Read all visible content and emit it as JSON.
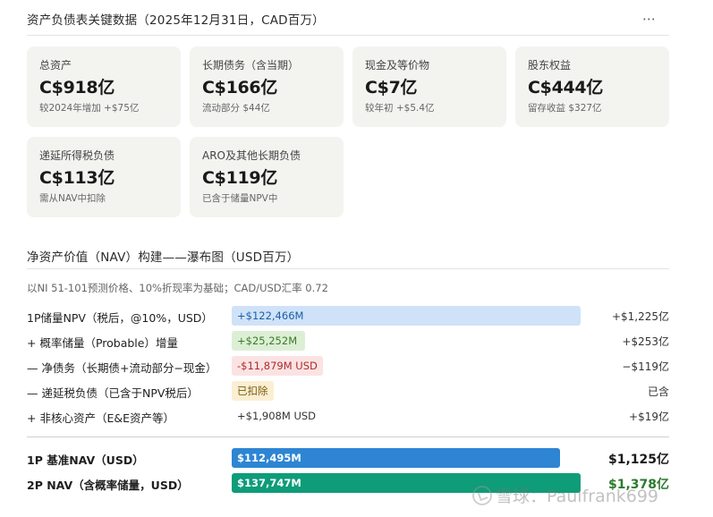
{
  "header": {
    "title": "资产负债表关键数据（2025年12月31日，CAD百万）",
    "more_icon": "⋯"
  },
  "cards": [
    {
      "label": "总资产",
      "value": "C$918亿",
      "sub": "较2024年增加 +$75亿"
    },
    {
      "label": "长期债务（含当期）",
      "value": "C$166亿",
      "sub": "流动部分 $44亿"
    },
    {
      "label": "现金及等价物",
      "value": "C$7亿",
      "sub": "较年初 +$5.4亿"
    },
    {
      "label": "股东权益",
      "value": "C$444亿",
      "sub": "留存收益 $327亿"
    },
    {
      "label": "递延所得税负债",
      "value": "C$113亿",
      "sub": "需从NAV中扣除"
    },
    {
      "label": "ARO及其他长期负债",
      "value": "C$119亿",
      "sub": "已含于储量NPV中"
    }
  ],
  "waterfall": {
    "title": "净资产价值（NAV）构建——瀑布图（USD百万）",
    "note": "以NI 51-101预测价格、10%折现率为基础；CAD/USD汇率 0.72",
    "rows": [
      {
        "label": "1P储量NPV（税后，@10%，USD）",
        "bar_text": "+$122,466M",
        "share": 1.0,
        "style": "bar-blue-light",
        "value": "+$1,225亿"
      },
      {
        "label": "+ 概率储量（Probable）增量",
        "bar_text": "+$25,252M",
        "share": 0.21,
        "style": "bar-green-light",
        "value": "+$253亿"
      },
      {
        "label": "— 净债务（长期债+流动部分−现金）",
        "bar_text": "-$11,879M USD",
        "share": 0.0,
        "style": "bar-red-light",
        "value": "−$119亿"
      },
      {
        "label": "— 递延税负债（已含于NPV税后）",
        "bar_text": "已扣除",
        "share": 0.0,
        "style": "bar-yellow-light",
        "value": "已含"
      },
      {
        "label": "+ 非核心资产（E&E资产等）",
        "bar_text": "+$1,908M USD",
        "share": 0.0,
        "style": "bar-none",
        "value": "+$19亿"
      }
    ],
    "totals": [
      {
        "label": "1P 基准NAV（USD）",
        "bar_text": "$112,495M",
        "share": 0.941,
        "style": "bar-blue",
        "value": "$1,125亿",
        "value_color": ""
      },
      {
        "label": "2P NAV（含概率储量，USD）",
        "bar_text": "$137,747M",
        "share": 1.0,
        "style": "bar-green",
        "value": "$1,378亿",
        "value_color": "total-value-green"
      }
    ]
  },
  "watermark": {
    "text": "雪球：Paulfrank699"
  }
}
